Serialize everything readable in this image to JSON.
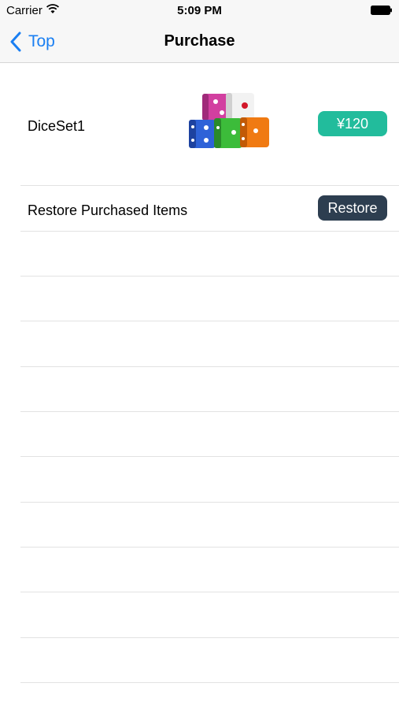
{
  "status_bar": {
    "carrier": "Carrier",
    "time": "5:09 PM"
  },
  "nav": {
    "back_label": "Top",
    "title": "Purchase"
  },
  "products": [
    {
      "name": "DiceSet1",
      "image": "dice-set-image",
      "price": "¥120"
    }
  ],
  "restore": {
    "label": "Restore Purchased Items",
    "button": "Restore"
  },
  "colors": {
    "accent": "#1a7ff2",
    "price_button": "#22bc9c",
    "restore_button": "#2d3e50"
  }
}
